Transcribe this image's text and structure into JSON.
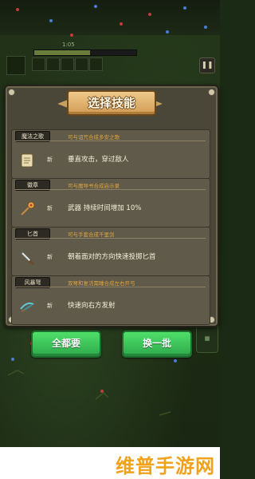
{
  "hud": {
    "timer": "1:05",
    "hp_fraction": 0.55,
    "pause_icon": "pause-icon",
    "side_button_icon": "map-icon"
  },
  "dialog": {
    "title": "选择技能",
    "skills": [
      {
        "name": "魔法之歌",
        "hint": "可与诅咒合成多安之歌",
        "icon": "scroll-icon",
        "new_label": "新",
        "description": "垂直攻击，穿过敌人"
      },
      {
        "name": "徽章",
        "hint": "可与魔导书合成启示录",
        "icon": "badge-icon",
        "new_label": "新",
        "description": "武器 持续时间增加 10%"
      },
      {
        "name": "匕首",
        "hint": "可与手套合成千里剑",
        "icon": "dagger-icon",
        "new_label": "新",
        "description": "朝着面对的方向快速投掷匕首"
      },
      {
        "name": "风暴弩",
        "hint": "双弩和复活需睡合成左右开弓",
        "icon": "crossbow-icon",
        "new_label": "新",
        "description": "快速向右方发射"
      }
    ]
  },
  "buttons": {
    "take_all": "全都要",
    "reroll": "换一批"
  },
  "watermark": "维普手游网",
  "colors": {
    "button_green": "#3cc257",
    "hint_orange": "#e0a540",
    "title_gold": "#d9a45e",
    "panel": "#4a4638"
  }
}
